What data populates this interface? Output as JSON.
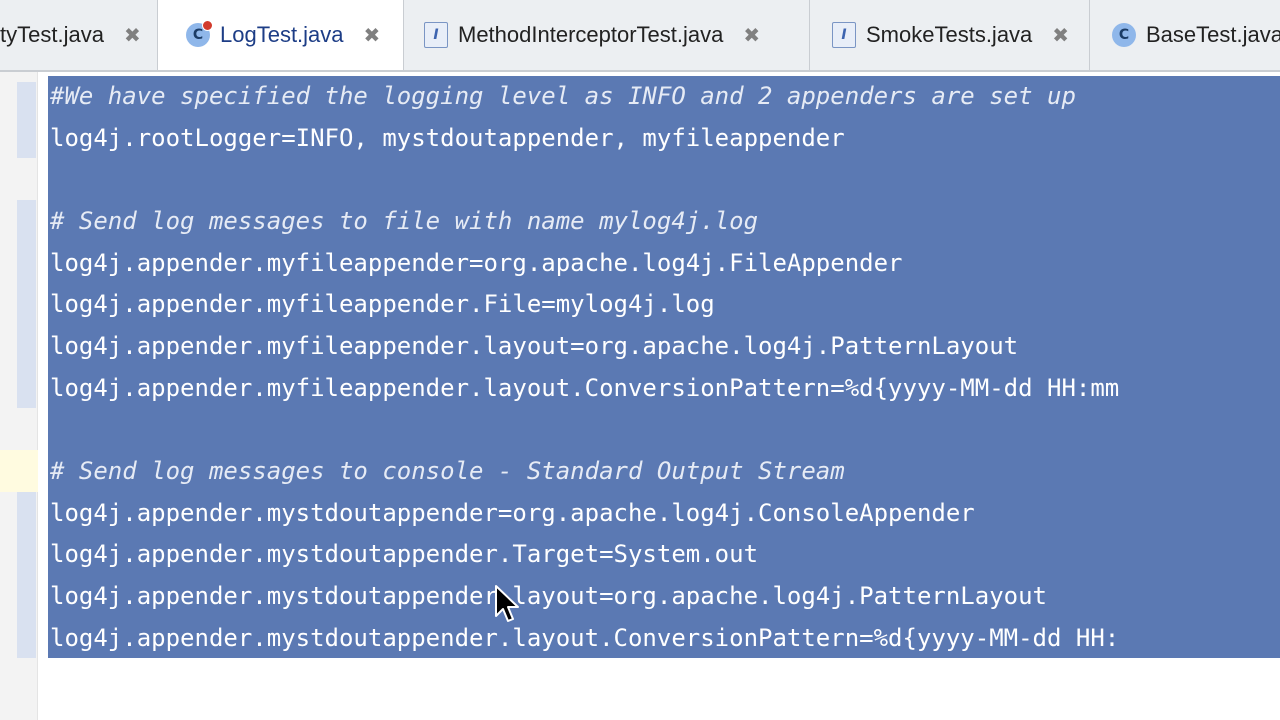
{
  "tabs": [
    {
      "label": "tyTest.java",
      "icon": "class-icon",
      "active": false
    },
    {
      "label": "LogTest.java",
      "icon": "class-run-icon",
      "active": true
    },
    {
      "label": "MethodInterceptorTest.java",
      "icon": "interface-icon",
      "active": false
    },
    {
      "label": "SmokeTests.java",
      "icon": "interface-icon",
      "active": false
    },
    {
      "label": "BaseTest.java",
      "icon": "class-icon",
      "active": false
    }
  ],
  "tab_close_glyph": "✖",
  "icon_glyphs": {
    "class": "C",
    "interface": "I"
  },
  "editor": {
    "lines": [
      "#We have specified the logging level as INFO and 2 appenders are set up",
      "log4j.rootLogger=INFO, mystdoutappender, myfileappender",
      "",
      "# Send log messages to file with name mylog4j.log",
      "log4j.appender.myfileappender=org.apache.log4j.FileAppender",
      "log4j.appender.myfileappender.File=mylog4j.log",
      "log4j.appender.myfileappender.layout=org.apache.log4j.PatternLayout",
      "log4j.appender.myfileappender.layout.ConversionPattern=%d{yyyy-MM-dd HH:mm",
      "",
      "# Send log messages to console - Standard Output Stream",
      "log4j.appender.mystdoutappender=org.apache.log4j.ConsoleAppender",
      "log4j.appender.mystdoutappender.Target=System.out",
      "log4j.appender.mystdoutappender.layout=org.apache.log4j.PatternLayout",
      "log4j.appender.mystdoutappender.layout.ConversionPattern=%d{yyyy-MM-dd HH:"
    ]
  },
  "colors": {
    "selection": "#5b79b3",
    "selected_text": "#ffffff",
    "tabbar_bg": "#eceff2",
    "active_tab_text": "#1d3d86"
  }
}
